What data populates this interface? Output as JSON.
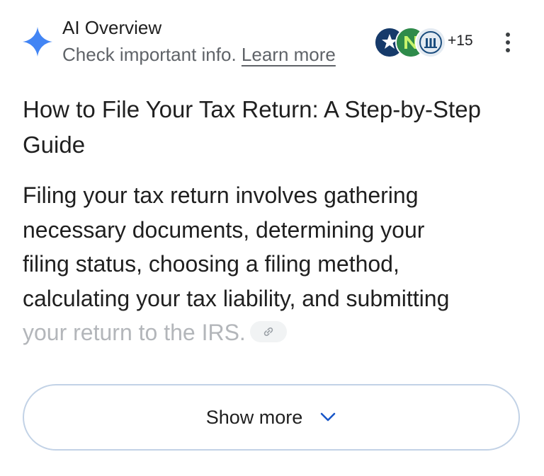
{
  "header": {
    "title": "AI Overview",
    "subtitle_prefix": "Check important info.",
    "learn_more": "Learn more",
    "sparkle_icon": "sparkle-icon",
    "source_count": "+15",
    "menu_icon": "more-vert-icon"
  },
  "colors": {
    "sparkle": "#4285f4",
    "button_border": "#c2d2e6",
    "muted_text": "#5f6368"
  },
  "content": {
    "title": "How to File Your Tax Return: A Step-by-Step Guide",
    "lines": [
      "Filing your tax return involves gathering",
      "necessary documents, determining your",
      "filing status, choosing a filing method,",
      "calculating your tax liability, and submitting",
      "your return to the IRS."
    ],
    "link_icon": "link-icon"
  },
  "show_more": {
    "label": "Show more",
    "icon": "chevron-down-icon"
  }
}
